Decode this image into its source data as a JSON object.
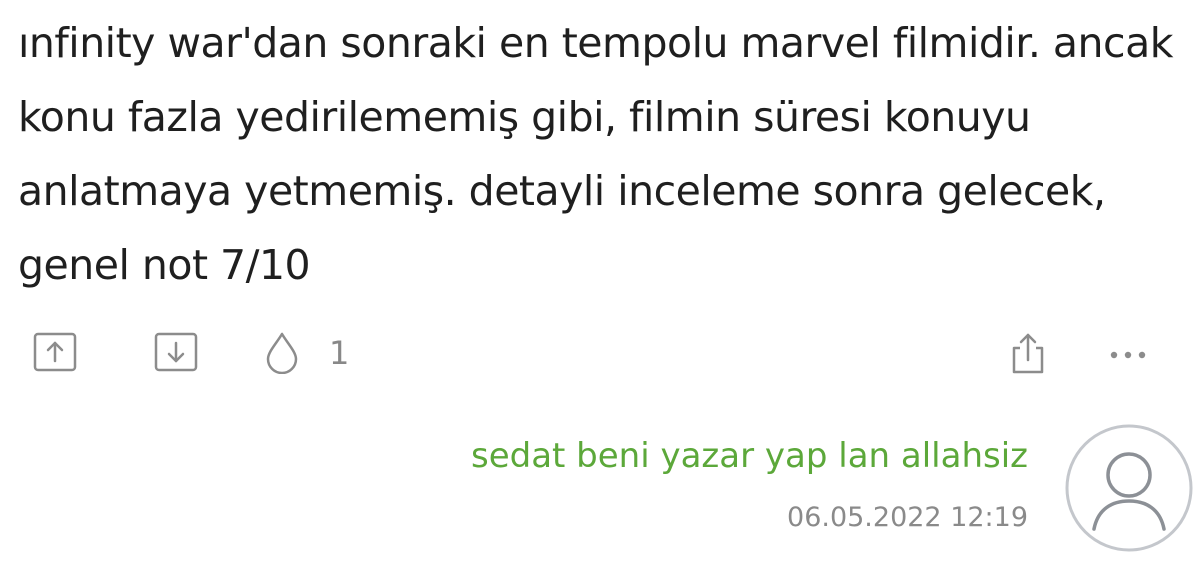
{
  "entry": {
    "lines": [
      "ınfinity war'dan sonraki en tempolu marvel filmidir. ancak",
      "konu fazla yedirilememiş gibi, filmin süresi konuyu",
      "anlatmaya yetmemiş. detayli inceleme sonra gelecek,",
      "genel not 7/10"
    ]
  },
  "actions": {
    "upvote_icon": "arrow-up-box-icon",
    "downvote_icon": "arrow-down-box-icon",
    "favorite_icon": "drop-icon",
    "favorite_count": "1",
    "share_icon": "share-icon",
    "more_icon": "ellipsis-icon"
  },
  "meta": {
    "author": "sedat beni yazar yap lan allahsiz",
    "timestamp": "06.05.2022 12:19"
  },
  "colors": {
    "author": "#5ca83a",
    "text": "#1f1f1f",
    "muted": "#8a8a8a"
  }
}
